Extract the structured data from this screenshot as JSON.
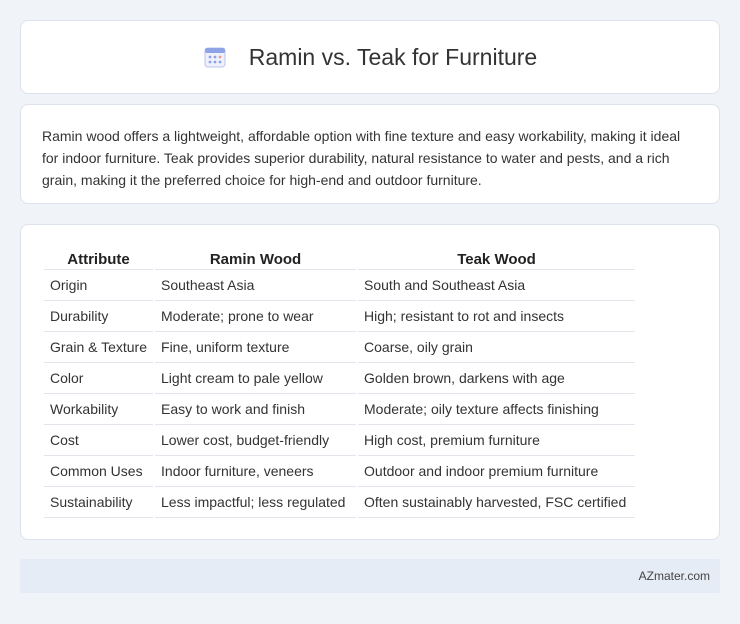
{
  "header": {
    "icon": "calendar-icon",
    "title": "Ramin vs. Teak for Furniture"
  },
  "intro": {
    "text": "Ramin wood offers a lightweight, affordable option with fine texture and easy workability, making it ideal for indoor furniture. Teak provides superior durability, natural resistance to water and pests, and a rich grain, making it the preferred choice for high-end and outdoor furniture."
  },
  "table": {
    "headers": [
      "Attribute",
      "Ramin Wood",
      "Teak Wood"
    ],
    "rows": [
      [
        "Origin",
        "Southeast Asia",
        "South and Southeast Asia"
      ],
      [
        "Durability",
        "Moderate; prone to wear",
        "High; resistant to rot and insects"
      ],
      [
        "Grain & Texture",
        "Fine, uniform texture",
        "Coarse, oily grain"
      ],
      [
        "Color",
        "Light cream to pale yellow",
        "Golden brown, darkens with age"
      ],
      [
        "Workability",
        "Easy to work and finish",
        "Moderate; oily texture affects finishing"
      ],
      [
        "Cost",
        "Lower cost, budget-friendly",
        "High cost, premium furniture"
      ],
      [
        "Common Uses",
        "Indoor furniture, veneers",
        "Outdoor and indoor premium furniture"
      ],
      [
        "Sustainability",
        "Less impactful; less regulated",
        "Often sustainably harvested, FSC certified"
      ]
    ]
  },
  "footer": {
    "brand": "AZmater.com"
  },
  "colors": {
    "background": "#f0f3f8",
    "card": "#ffffff",
    "footer": "#e6ecf6",
    "icon_accent": "#8ea2e6"
  }
}
